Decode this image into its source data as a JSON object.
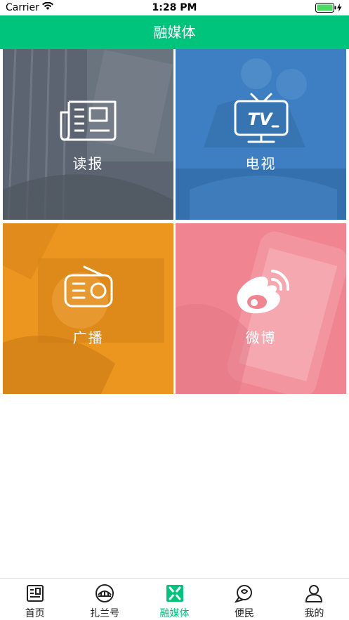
{
  "status_bar": {
    "carrier": "Carrier",
    "time": "1:28 PM"
  },
  "navbar": {
    "title": "融媒体"
  },
  "tiles": [
    {
      "label": "读报",
      "icon": "newspaper-icon",
      "color": "#5b6470"
    },
    {
      "label": "电视",
      "icon": "tv-icon",
      "color": "#3d7fc2"
    },
    {
      "label": "广播",
      "icon": "radio-icon",
      "color": "#ec951f"
    },
    {
      "label": "微博",
      "icon": "weibo-icon",
      "color": "#f08591"
    }
  ],
  "tabbar": {
    "items": [
      {
        "label": "首页",
        "icon": "home-news-icon"
      },
      {
        "label": "扎兰号",
        "icon": "bridge-icon"
      },
      {
        "label": "融媒体",
        "icon": "media-icon",
        "active": true
      },
      {
        "label": "便民",
        "icon": "service-icon"
      },
      {
        "label": "我的",
        "icon": "user-icon"
      }
    ],
    "active_color": "#00c37c"
  },
  "colors": {
    "brand": "#00c37c"
  }
}
